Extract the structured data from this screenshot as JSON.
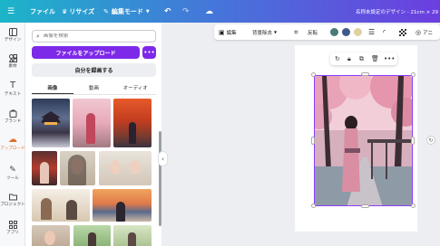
{
  "topbar": {
    "file_label": "ファイル",
    "resize_label": "リサイズ",
    "mode_label": "編集モード",
    "doc_title": "名称未設定のデザイン - 21cm × 29"
  },
  "rail": [
    {
      "label": "デザイン",
      "icon": "layout-icon"
    },
    {
      "label": "素材",
      "icon": "elements-icon"
    },
    {
      "label": "テキスト",
      "icon": "text-icon"
    },
    {
      "label": "ブランド",
      "icon": "brand-icon"
    },
    {
      "label": "アップロード",
      "icon": "upload-icon"
    },
    {
      "label": "ツール",
      "icon": "tools-icon"
    },
    {
      "label": "プロジェクト",
      "icon": "folder-icon"
    },
    {
      "label": "アプリ",
      "icon": "apps-icon"
    }
  ],
  "panel": {
    "search_placeholder": "画像を検索",
    "upload_label": "ファイルをアップロード",
    "more_label": "•••",
    "record_label": "自分を録画する",
    "tabs": [
      "画像",
      "動画",
      "オーディオ"
    ]
  },
  "toolbar": {
    "edit_label": "編集",
    "bg_remove_label": "背景除去",
    "flip_label": "反転",
    "animate_label": "アニ",
    "swatches": [
      "#4a7a78",
      "#3d5a8a",
      "#e0d1a4"
    ]
  },
  "colors": {
    "accent": "#7d2ae8",
    "selection": "#8b3dff",
    "active_rail": "#e0702a"
  }
}
